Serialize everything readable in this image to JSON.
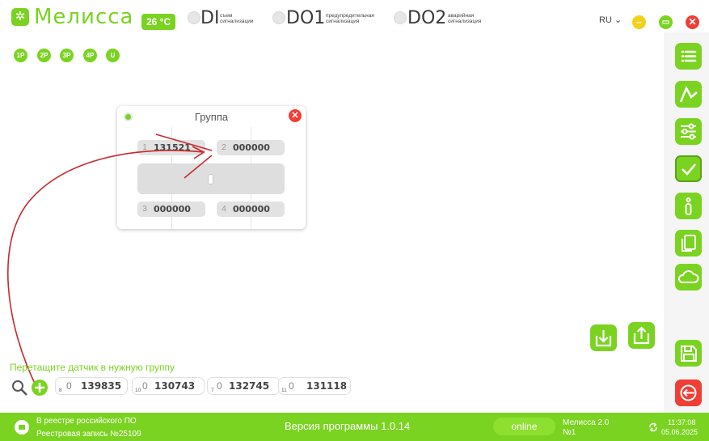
{
  "header": {
    "app_title": "Мелисса",
    "temperature": "26 °C",
    "indicators": [
      {
        "code": "DI",
        "sub1": "съем",
        "sub2": "сигнализации"
      },
      {
        "code": "DO1",
        "sub1": "предупредительная",
        "sub2": "сигнализация"
      },
      {
        "code": "DO2",
        "sub1": "аварийная",
        "sub2": "сигнализация"
      }
    ],
    "language": "RU",
    "language_caret": "⌄",
    "colors": {
      "accent": "#7bd321",
      "minimize": "#f2d11a",
      "danger": "#ef3e36"
    }
  },
  "phases": [
    "1P",
    "2P",
    "3P",
    "4P",
    "U"
  ],
  "group_card": {
    "title": "Группа",
    "close": "✕",
    "slots": [
      {
        "num": "1",
        "value": "131521"
      },
      {
        "num": "2",
        "value": "000000"
      },
      {
        "num": "3",
        "value": "000000"
      },
      {
        "num": "4",
        "value": "000000"
      }
    ]
  },
  "sidebar": {
    "items": [
      "list-icon",
      "chart-icon",
      "sliders-icon",
      "check-icon",
      "info-icon",
      "document-icon",
      "cloud-icon",
      "save-icon",
      "exit-icon"
    ]
  },
  "sensors": {
    "hint": "Перетащите датчик в нужную группу",
    "items": [
      {
        "sub": "8",
        "zero": "0",
        "value": "139835"
      },
      {
        "sub": "10",
        "zero": "0",
        "value": "130743"
      },
      {
        "sub": "7",
        "zero": "0",
        "value": "132745"
      },
      {
        "sub": "11",
        "zero": "0",
        "value": "131118"
      }
    ]
  },
  "footer": {
    "registry_line1": "В реестре российского ПО",
    "registry_line2": "Реестровая запись №25109",
    "version": "Версия программы  1.0.14",
    "status": "online",
    "device_line1": "Мелисса 2.0",
    "device_line2": "№1",
    "time": "11:37:08",
    "date": "05.06.2025"
  }
}
